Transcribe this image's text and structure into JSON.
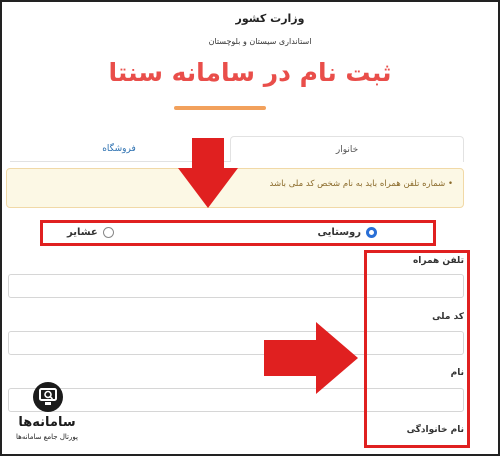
{
  "header": {
    "ministry": "وزارت کشور",
    "province": "استانداری سیستان و بلوچستان",
    "title": "ثبت نام در سامانه سنتا"
  },
  "tabs": [
    {
      "label": "فروشگاه"
    },
    {
      "label": "خانوار"
    }
  ],
  "alert": {
    "text": "• شماره تلفن همراه باید به نام شخص کد ملی باشد"
  },
  "residence": {
    "options": [
      {
        "label": "روستایی",
        "selected": true
      },
      {
        "label": "عشایر",
        "selected": false
      }
    ]
  },
  "fields": [
    {
      "label": "تلفن همراه",
      "value": ""
    },
    {
      "label": "کد ملی",
      "value": ""
    },
    {
      "label": "نام",
      "value": ""
    },
    {
      "label": "نام خانوادگی",
      "value": ""
    }
  ],
  "watermark": {
    "name": "سامانه‌ها",
    "tagline": "پورتال جامع سامانه‌ها"
  },
  "colors": {
    "title": "#e94e4a",
    "annotation": "#e02020",
    "radio_selected": "#2a6fd6"
  }
}
